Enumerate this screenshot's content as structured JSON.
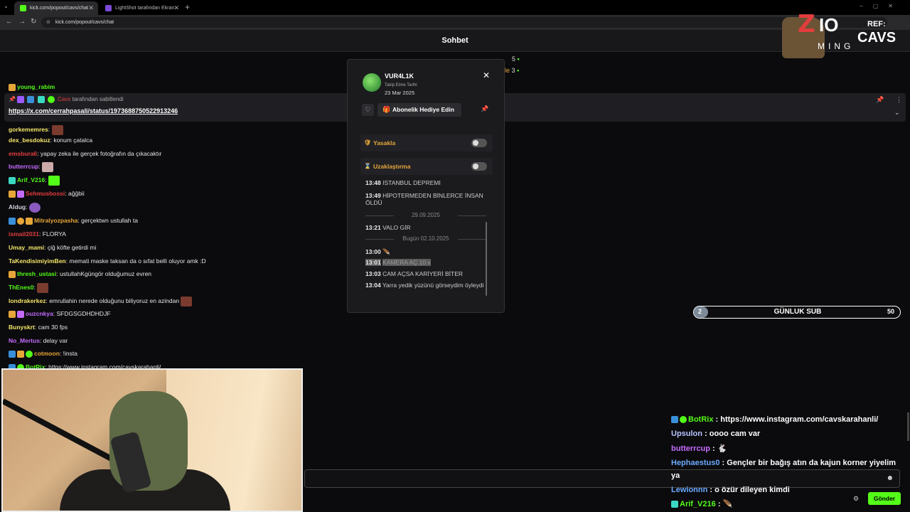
{
  "browser": {
    "tabs": [
      {
        "title": "kick.com/popout/cavs/chat",
        "active": true,
        "favicon_color": "#53fc18"
      },
      {
        "title": "LightShot tarafından Ekran Gö...",
        "active": false,
        "favicon_color": "#7a4bd6"
      }
    ],
    "url": "kick.com/popout/cavs/chat"
  },
  "chat": {
    "title": "Sohbet",
    "pinned": {
      "by_user": "Cavs",
      "by_text": "tarafından sabitlendi",
      "link": "https://x.com/cerrahpasali/status/1973688750522913246"
    },
    "messages": [
      {
        "user": "gorkememres",
        "color": "#f5e76a",
        "text": ""
      },
      {
        "user": "dex_besdokuz",
        "color": "#f5e76a",
        "text": "konum çatalca"
      },
      {
        "user": "emsbura6",
        "color": "#e23d3d",
        "text": "yapay zeka ile gerçek fotoğrafın da çıkacaktır"
      },
      {
        "user": "butterrcup",
        "color": "#c56bff",
        "text": ""
      },
      {
        "user": "Arif_V216",
        "color": "#53fc18",
        "text": ""
      },
      {
        "user": "Sehmusbossi",
        "color": "#e23d3d",
        "text": "ağğbii"
      },
      {
        "user": "Aldug",
        "color": "#cfd3dc",
        "text": ""
      },
      {
        "user": "Mitralyozpasha",
        "color": "#e7a63a",
        "text": "gerçektwn ustullah ta"
      },
      {
        "user": "ismail2031",
        "color": "#e23d3d",
        "text": "FLORYA"
      },
      {
        "user": "Umay_mami",
        "color": "#f5e76a",
        "text": "çiğ köfte getirdi mi"
      },
      {
        "user": "TaKendisimiyimBen",
        "color": "#f5e76a",
        "text": "memati maske taksan da o sıfat belli oluyor amk :D"
      },
      {
        "user": "thresh_ustasi",
        "color": "#53fc18",
        "text": "ustullahKgüngör olduğumuz evren"
      },
      {
        "user": "ThEnes0",
        "color": "#53fc18",
        "text": ""
      },
      {
        "user": "londrakerkez",
        "color": "#f5e76a",
        "text": "emrullahin nerede olduğunu biliyoruz en azindan"
      },
      {
        "user": "ouzcnkya",
        "color": "#c56bff",
        "text": "SFDGSGDHDHDJF"
      },
      {
        "user": "Bunyskrt",
        "color": "#f5e76a",
        "text": "cam 30 fps"
      },
      {
        "user": "No_Mertus",
        "color": "#c56bff",
        "text": "delay var"
      },
      {
        "user": "cotmoon",
        "color": "#e7a63a",
        "text": "!insta"
      },
      {
        "user": "BotRix",
        "color": "#53fc18",
        "text": "https://www.instagram.com/cavskarahanli/"
      }
    ]
  },
  "top_overlay": {
    "line1": "5",
    "line2_prefix": "le",
    "line2": "3"
  },
  "brand": {
    "ref_label": "REF:",
    "ref_name": "CAVS",
    "logo_text": "ZIO",
    "logo_sub": "MING"
  },
  "popup": {
    "username": "VUR4L1K",
    "follow_label": "Takip Etme Tarihi",
    "follow_date": "23 Mar 2025",
    "gift_label": "Abonelik Hediye Edin",
    "ban_label": "Yasakla",
    "timeout_label": "Uzaklaştırma",
    "history": [
      {
        "time": "13:48",
        "text": "İSTANBUL DEPREMİ"
      },
      {
        "time": "13:49",
        "text": "HİPOTERMEDEN BİNLERCE İNSAN ÖLDÜ"
      },
      {
        "date": "29.09.2025"
      },
      {
        "time": "13:21",
        "text": "VALO GİR"
      },
      {
        "date": "Bugün 02.10.2025"
      },
      {
        "time": "13:00",
        "text": ""
      },
      {
        "time": "13:01",
        "text": "KAMERA AÇ 10 x"
      },
      {
        "time": "13:03",
        "text": "CAM AÇSA KARİYERİ BİTER"
      },
      {
        "time": "13:04",
        "text": "Yarra yedik yüzünü görseydim öyleydi"
      }
    ]
  },
  "sub_goal": {
    "current": "2",
    "label": "GÜNLUK SUB",
    "goal": "50",
    "progress": 0.04
  },
  "overlay_chat": [
    {
      "user": "BotRix",
      "color": "#53fc18",
      "text": "https://www.instagram.com/cavskarahanli/"
    },
    {
      "user": "Upsulon",
      "color": "#b7c2ff",
      "text": "oooo cam var"
    },
    {
      "user": "butterrcup",
      "color": "#c56bff",
      "text": ""
    },
    {
      "user": "Hephaestus0",
      "color": "#6aa9ff",
      "text": "Gençler bir bağış atın da kajun korner yiyelim"
    },
    {
      "user": "",
      "color": "#fff",
      "text": "ya"
    },
    {
      "user": "Lewionnn",
      "color": "#6aa9ff",
      "text": "o özür dileyen kimdi"
    },
    {
      "user": "Arif_V216",
      "color": "#53fc18",
      "text": ""
    }
  ],
  "send_label": "Gönder"
}
